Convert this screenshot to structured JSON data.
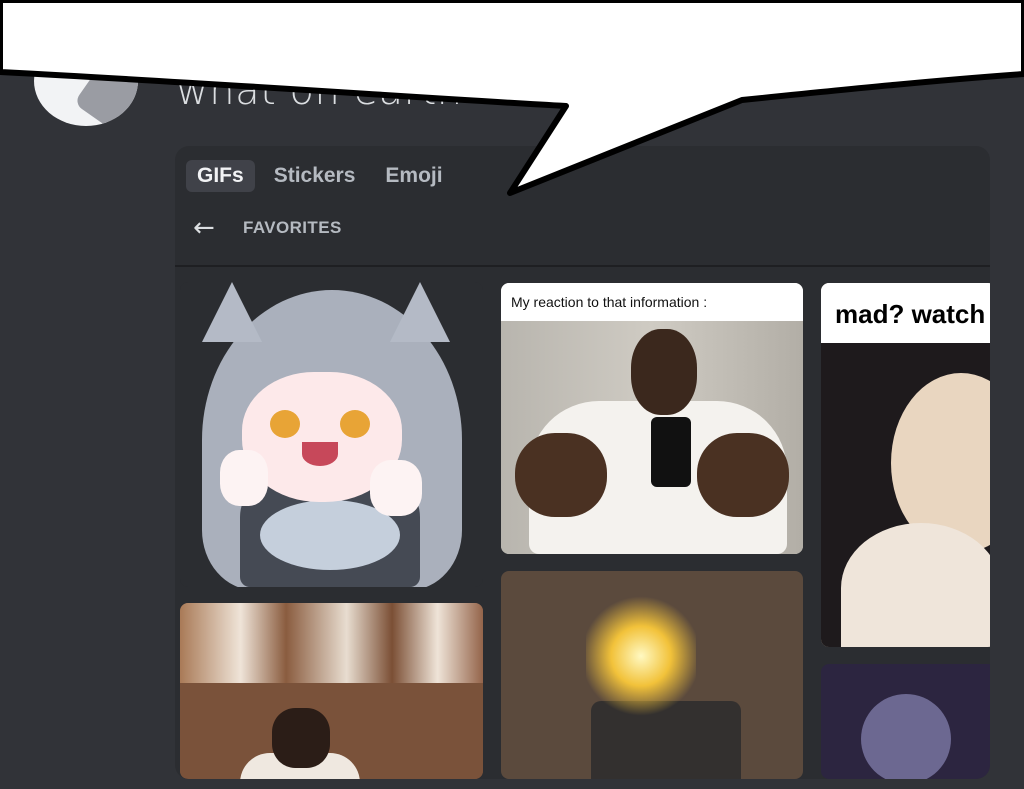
{
  "message": {
    "text": "what on earth"
  },
  "picker": {
    "tabs": [
      {
        "label": "GIFs",
        "active": true
      },
      {
        "label": "Stickers",
        "active": false
      },
      {
        "label": "Emoji",
        "active": false
      }
    ],
    "back_icon": "left-arrow",
    "section_label": "FAVORITES",
    "gifs": [
      {
        "caption": ""
      },
      {
        "caption": "My reaction to that information :"
      },
      {
        "caption": "mad? watch"
      },
      {
        "caption": ""
      },
      {
        "caption": ""
      },
      {
        "caption": ""
      }
    ]
  },
  "colors": {
    "background": "#313338",
    "picker_background": "#2b2d31",
    "active_tab": "#404249",
    "speech_bubble": "#ffffff"
  }
}
